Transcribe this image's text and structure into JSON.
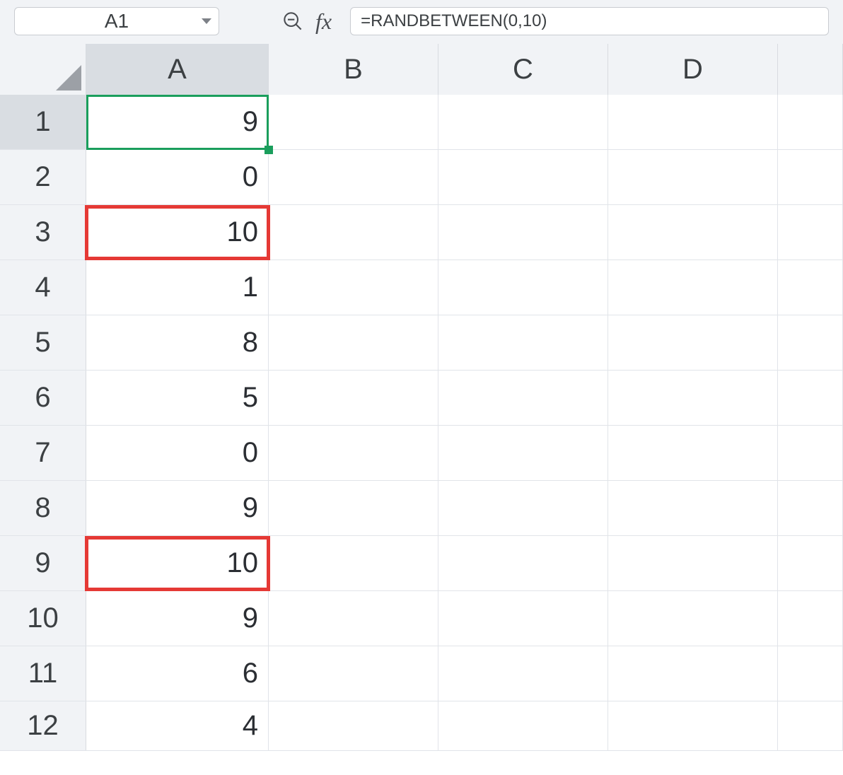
{
  "namebox": {
    "value": "A1"
  },
  "formula_bar": {
    "value": "=RANDBETWEEN(0,10)"
  },
  "columns": [
    "A",
    "B",
    "C",
    "D",
    ""
  ],
  "selected_column": "A",
  "selected_row": 1,
  "rows": [
    {
      "n": "1",
      "values": [
        "9",
        "",
        "",
        "",
        ""
      ]
    },
    {
      "n": "2",
      "values": [
        "0",
        "",
        "",
        "",
        ""
      ]
    },
    {
      "n": "3",
      "values": [
        "10",
        "",
        "",
        "",
        ""
      ]
    },
    {
      "n": "4",
      "values": [
        "1",
        "",
        "",
        "",
        ""
      ]
    },
    {
      "n": "5",
      "values": [
        "8",
        "",
        "",
        "",
        ""
      ]
    },
    {
      "n": "6",
      "values": [
        "5",
        "",
        "",
        "",
        ""
      ]
    },
    {
      "n": "7",
      "values": [
        "0",
        "",
        "",
        "",
        ""
      ]
    },
    {
      "n": "8",
      "values": [
        "9",
        "",
        "",
        "",
        ""
      ]
    },
    {
      "n": "9",
      "values": [
        "10",
        "",
        "",
        "",
        ""
      ]
    },
    {
      "n": "10",
      "values": [
        "9",
        "",
        "",
        "",
        ""
      ]
    },
    {
      "n": "11",
      "values": [
        "6",
        "",
        "",
        "",
        ""
      ]
    },
    {
      "n": "12",
      "values": [
        "4",
        "",
        "",
        "",
        ""
      ]
    }
  ],
  "highlights": {
    "red_boxes": [
      {
        "row": 3,
        "col": "A"
      },
      {
        "row": 9,
        "col": "A"
      }
    ]
  },
  "active_cell": "A1"
}
